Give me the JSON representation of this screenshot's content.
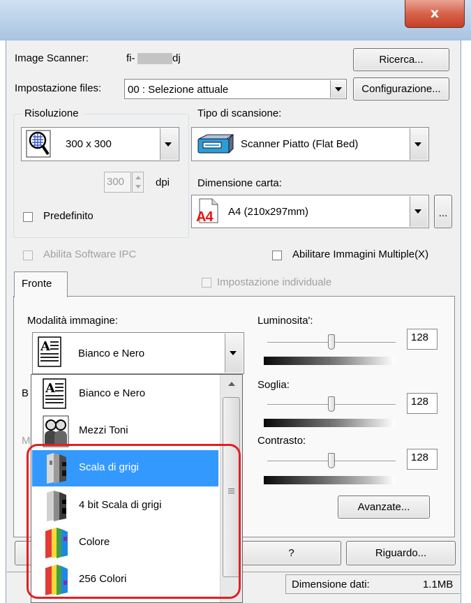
{
  "titlebar": {
    "close_label": "x"
  },
  "scanner": {
    "label": "Image Scanner:",
    "model_prefix": "fi-",
    "model_suffix": "dj",
    "search_button": "Ricerca..."
  },
  "file_settings": {
    "label": "Impostazione files:",
    "value": "00 : Selezione attuale",
    "config_button": "Configurazione..."
  },
  "resolution": {
    "group_label": "Risoluzione",
    "value": "300 x 300",
    "dpi_value": "300",
    "dpi_unit": "dpi",
    "default_label": "Predefinito"
  },
  "scan_type": {
    "label": "Tipo di scansione:",
    "value": "Scanner Piatto (Flat Bed)"
  },
  "paper_size": {
    "label": "Dimensione carta:",
    "value": "A4 (210x297mm)",
    "icon_text": "A4",
    "more_button": "..."
  },
  "ipc": {
    "label": "Abilita Software IPC"
  },
  "multi_image": {
    "label": "Abilitare Immagini Multiple(X)"
  },
  "tab": {
    "front_label": "Fronte",
    "individual_label": "Impostazione individuale"
  },
  "image_mode": {
    "label": "Modalità immagine:",
    "value": "Bianco e Nero"
  },
  "dropdown": {
    "items": [
      {
        "label": "Bianco e Nero",
        "icon": "document-text-icon"
      },
      {
        "label": "Mezzi Toni",
        "icon": "halftone-people-icon"
      },
      {
        "label": "Scala di grigi",
        "icon": "grayscale-icon",
        "selected": true
      },
      {
        "label": "4 bit Scala di grigi",
        "icon": "grayscale-4bit-icon"
      },
      {
        "label": "Colore",
        "icon": "color-icon"
      },
      {
        "label": "256 Colori",
        "icon": "color-256-icon"
      }
    ],
    "hidden_labels": [
      "B",
      "M"
    ]
  },
  "brightness": {
    "label": "Luminosita':",
    "value": "128"
  },
  "threshold": {
    "label": "Soglia:",
    "value": "128"
  },
  "contrast": {
    "label": "Contrasto:",
    "value": "128"
  },
  "advanced_button": "Avanzate...",
  "help_button": "?",
  "about_button": "Riguardo...",
  "status": {
    "data_size_label": "Dimensione dati:",
    "data_size_value": "1.1MB"
  },
  "colors": {
    "highlight": "#3399ff",
    "annotation_red": "#e31e24",
    "window_frame": "#b9d1ea",
    "close_button": "#c9432a"
  }
}
